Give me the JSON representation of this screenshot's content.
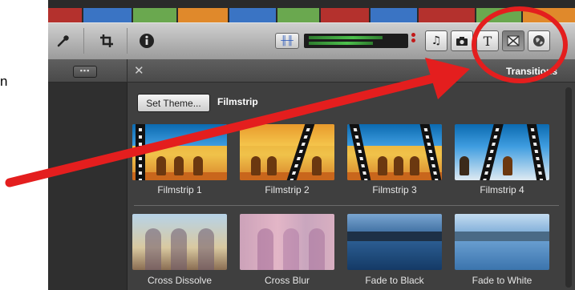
{
  "edge_text": "n",
  "toolbar": {
    "mic_icon": "microphone-icon",
    "crop_icon": "crop-icon",
    "info_icon": "info-icon",
    "audio_icon": "waveform-icon",
    "browser_buttons": [
      "music-icon",
      "camera-icon",
      "text-icon",
      "transitions-icon",
      "globe-icon"
    ],
    "text_button_label": "T"
  },
  "subbar": {
    "toggle_label": "▪▪▪",
    "close_label": "✕",
    "panel_title": "Transitions"
  },
  "browser": {
    "set_theme_label": "Set Theme...",
    "theme_name": "Filmstrip",
    "transitions": [
      {
        "label": "Filmstrip 1"
      },
      {
        "label": "Filmstrip 2"
      },
      {
        "label": "Filmstrip 3"
      },
      {
        "label": "Filmstrip 4"
      },
      {
        "label": "Cross Dissolve"
      },
      {
        "label": "Cross Blur"
      },
      {
        "label": "Fade to Black"
      },
      {
        "label": "Fade to White"
      }
    ]
  },
  "colors": {
    "annotation_red": "#e41e1e",
    "toolbar_gray": "#b5b5b5",
    "panel_dark": "#3f3f3f"
  }
}
